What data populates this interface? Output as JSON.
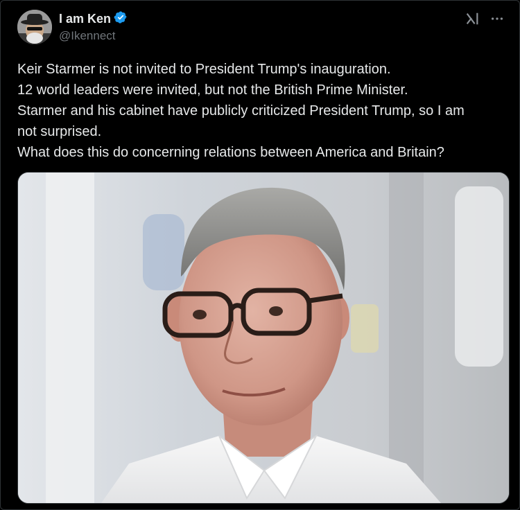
{
  "author": {
    "display_name": "I am Ken",
    "handle": "@Ikennect",
    "verified_icon": "verified-badge-icon",
    "avatar_icon": "avatar"
  },
  "actions": {
    "grok_icon": "grok-icon",
    "more_icon": "more-options-icon"
  },
  "tweet": {
    "lines": [
      "Keir Starmer is not invited to President Trump's inauguration.",
      "12 world leaders were invited, but not the British Prime Minister.",
      "Starmer and his cabinet have publicly criticized President Trump, so I am",
      "not surprised.",
      "What does this do concerning relations between America and Britain?"
    ]
  },
  "colors": {
    "background": "#000000",
    "text": "#e7e9ea",
    "secondary_text": "#71767b",
    "verified_blue": "#1d9bf0",
    "border": "#2f3336"
  }
}
